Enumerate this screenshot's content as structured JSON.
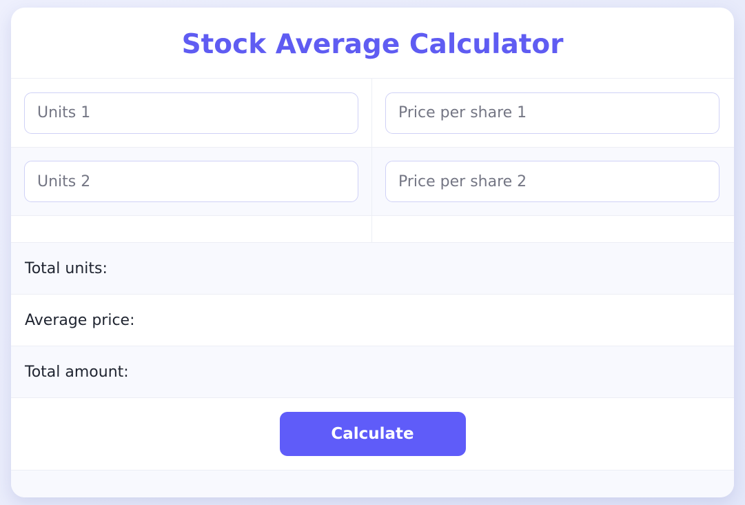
{
  "title": "Stock Average Calculator",
  "inputs": {
    "units_1": {
      "placeholder": "Units 1",
      "value": ""
    },
    "price_1": {
      "placeholder": "Price per share 1",
      "value": ""
    },
    "units_2": {
      "placeholder": "Units 2",
      "value": ""
    },
    "price_2": {
      "placeholder": "Price per share 2",
      "value": ""
    }
  },
  "results": {
    "total_units_label": "Total units:",
    "total_units_value": "",
    "average_price_label": "Average price:",
    "average_price_value": "",
    "total_amount_label": "Total amount:",
    "total_amount_value": ""
  },
  "actions": {
    "calculate_label": "Calculate"
  },
  "colors": {
    "accent": "#5f5cf9",
    "title": "#5f5cf2",
    "background": "#eef0fd"
  }
}
